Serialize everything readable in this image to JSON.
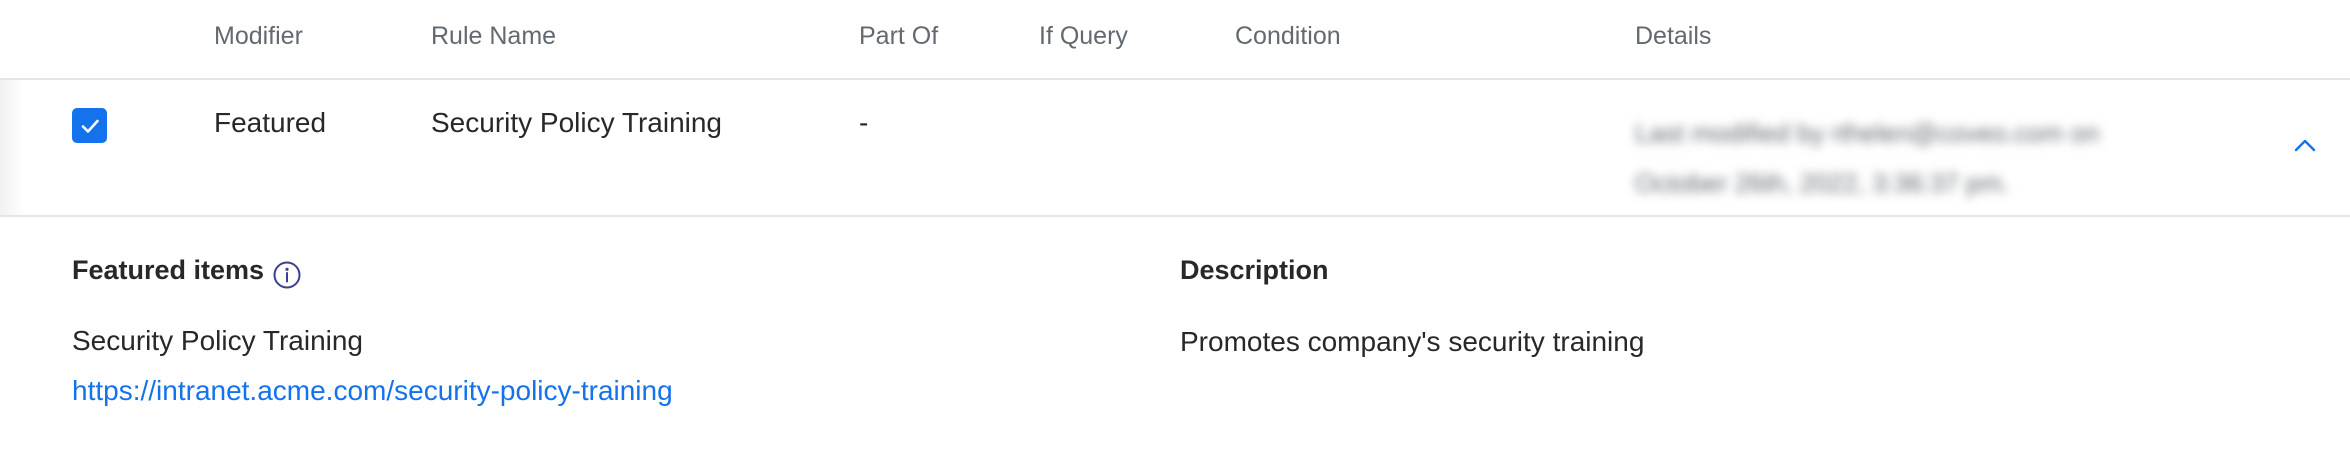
{
  "table": {
    "columns": [
      {
        "key": "modifier",
        "label": "Modifier"
      },
      {
        "key": "rule_name",
        "label": "Rule Name"
      },
      {
        "key": "part_of",
        "label": "Part Of"
      },
      {
        "key": "if_query",
        "label": "If Query"
      },
      {
        "key": "condition",
        "label": "Condition"
      },
      {
        "key": "details",
        "label": "Details"
      }
    ],
    "row": {
      "selected": true,
      "modifier": "Featured",
      "rule_name": "Security Policy Training",
      "part_of": "-",
      "if_query": "",
      "condition": "",
      "details_line1": "Last modified by rthelen@coveo.com on",
      "details_line2": "October 26th, 2022, 3:36:37 pm."
    }
  },
  "expanded": {
    "featured_title": "Featured items",
    "featured_item_name": "Security Policy Training",
    "featured_item_url": "https://intranet.acme.com/security-policy-training",
    "description_title": "Description",
    "description_text": "Promotes company's security training"
  },
  "icons": {
    "checkbox": "checkmark-icon",
    "collapse": "chevron-up-icon",
    "info": "info-icon"
  },
  "colors": {
    "accent": "#1372ec",
    "header_text": "#626971",
    "body_text": "#282829",
    "divider": "#e3e5ea"
  }
}
